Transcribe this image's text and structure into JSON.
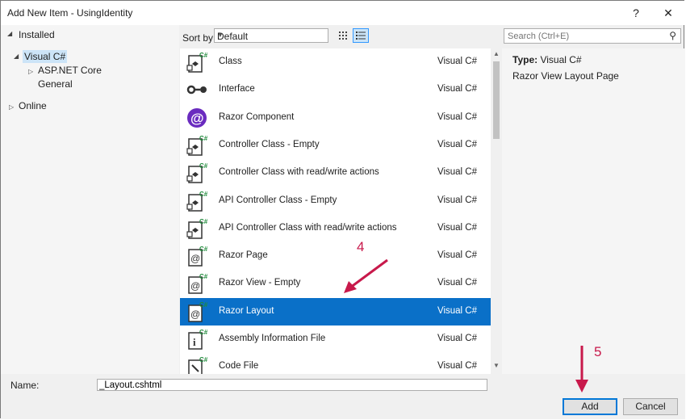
{
  "window": {
    "title": "Add New Item - UsingIdentity",
    "help_glyph": "?",
    "close_glyph": "✕"
  },
  "tree": {
    "installed": "Installed",
    "visual_csharp": "Visual C#",
    "aspnet_core": "ASP.NET Core",
    "general": "General",
    "online": "Online"
  },
  "toolbar": {
    "sort_label": "Sort by:",
    "sort_value": "Default"
  },
  "search": {
    "placeholder": "Search (Ctrl+E)"
  },
  "items": [
    {
      "name": "Class",
      "lang": "Visual C#",
      "icon": "class-icon"
    },
    {
      "name": "Interface",
      "lang": "Visual C#",
      "icon": "interface-icon"
    },
    {
      "name": "Razor Component",
      "lang": "Visual C#",
      "icon": "razor-component-icon"
    },
    {
      "name": "Controller Class - Empty",
      "lang": "Visual C#",
      "icon": "controller-icon"
    },
    {
      "name": "Controller Class with read/write actions",
      "lang": "Visual C#",
      "icon": "controller-icon"
    },
    {
      "name": "API Controller Class - Empty",
      "lang": "Visual C#",
      "icon": "controller-icon"
    },
    {
      "name": "API Controller Class with read/write actions",
      "lang": "Visual C#",
      "icon": "controller-icon"
    },
    {
      "name": "Razor Page",
      "lang": "Visual C#",
      "icon": "razor-page-icon"
    },
    {
      "name": "Razor View - Empty",
      "lang": "Visual C#",
      "icon": "razor-page-icon"
    },
    {
      "name": "Razor Layout",
      "lang": "Visual C#",
      "icon": "razor-page-icon",
      "selected": true
    },
    {
      "name": "Assembly Information File",
      "lang": "Visual C#",
      "icon": "info-file-icon"
    },
    {
      "name": "Code File",
      "lang": "Visual C#",
      "icon": "code-file-icon"
    }
  ],
  "details": {
    "type_label": "Type:",
    "type_value": "Visual C#",
    "description": "Razor View Layout Page"
  },
  "bottom": {
    "name_label": "Name:",
    "name_value": "_Layout.cshtml",
    "add_label": "Add",
    "cancel_label": "Cancel"
  },
  "annotations": {
    "step4": "4",
    "step5": "5",
    "color": "#c8194b"
  }
}
